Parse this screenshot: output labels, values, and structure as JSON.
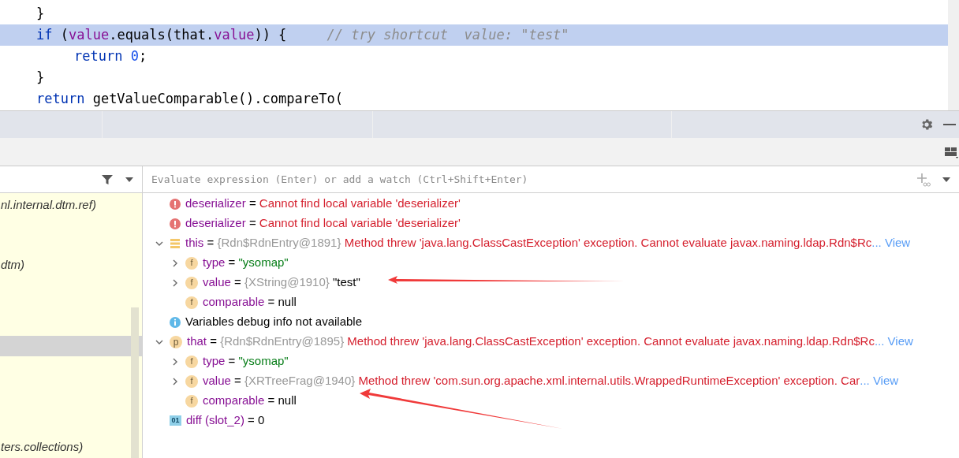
{
  "editor": {
    "lines": [
      {
        "highlighted": false,
        "tokens": [
          {
            "kind": "plain",
            "text": "}"
          }
        ]
      },
      {
        "highlighted": true,
        "tokens": [
          {
            "kind": "keyword",
            "text": "if"
          },
          {
            "kind": "plain",
            "text": " ("
          },
          {
            "kind": "field",
            "text": "value"
          },
          {
            "kind": "plain",
            "text": ".equals(that."
          },
          {
            "kind": "field",
            "text": "value"
          },
          {
            "kind": "plain",
            "text": ")) {"
          },
          {
            "kind": "comment",
            "text": "     // try shortcut  value: \"test\""
          }
        ],
        "children": [
          {
            "highlighted": false,
            "tokens": [
              {
                "kind": "keyword",
                "text": "return"
              },
              {
                "kind": "number",
                "text": " 0"
              },
              {
                "kind": "plain",
                "text": ";"
              }
            ]
          }
        ]
      },
      {
        "highlighted": false,
        "tokens": [
          {
            "kind": "plain",
            "text": "}"
          }
        ]
      },
      {
        "highlighted": false,
        "tokens": [
          {
            "kind": "keyword",
            "text": "return"
          },
          {
            "kind": "plain",
            "text": " getValueComparable().compareTo("
          }
        ]
      }
    ]
  },
  "frames": {
    "items": [
      {
        "label": "nl.internal.dtm.ref)",
        "selected": false
      },
      {
        "selected": false
      },
      {
        "selected": false
      },
      {
        "label": "dtm)",
        "selected": false
      },
      {
        "selected": false
      },
      {
        "selected": false
      },
      {
        "selected": false
      },
      {
        "selected": true
      },
      {
        "selected": false
      },
      {
        "selected": false
      },
      {
        "selected": false
      },
      {
        "selected": false
      },
      {
        "label": "ters.collections)",
        "selected": false
      }
    ]
  },
  "watch": {
    "placeholder": "Evaluate expression (Enter) or add a watch (Ctrl+Shift+Enter)"
  },
  "variables": [
    {
      "kind": "error",
      "name": "deserializer",
      "operator": "=",
      "value": {
        "kind": "error",
        "text": "Cannot find local variable 'deserializer'"
      }
    },
    {
      "kind": "error",
      "name": "deserializer",
      "operator": "=",
      "value": {
        "kind": "error",
        "text": "Cannot find local variable 'deserializer'"
      }
    },
    {
      "kind": "object",
      "name": "this",
      "operator": "=",
      "expanded": true,
      "ref": "{Rdn$RdnEntry@1891}",
      "value": {
        "kind": "error",
        "text": "Method threw 'java.lang.ClassCastException' exception. Cannot evaluate javax.naming.ldap.Rdn$Rc"
      },
      "link": "... View",
      "children": [
        {
          "kind": "field",
          "badge": "f",
          "name": "type",
          "operator": "=",
          "expanded": false,
          "value": {
            "kind": "string",
            "text": "\"ysomap\""
          }
        },
        {
          "kind": "field",
          "badge": "f",
          "name": "value",
          "operator": "=",
          "expanded": false,
          "ref": "{XString@1910}",
          "value": {
            "kind": "plain",
            "text": "\"test\""
          }
        },
        {
          "kind": "field",
          "badge": "f",
          "name": "comparable",
          "operator": "=",
          "value": {
            "kind": "plain",
            "text": "null"
          }
        }
      ]
    },
    {
      "kind": "info",
      "name": "Variables debug info not available"
    },
    {
      "kind": "param",
      "badge": "p",
      "name": "that",
      "operator": "=",
      "expanded": true,
      "ref": "{Rdn$RdnEntry@1895}",
      "value": {
        "kind": "error",
        "text": "Method threw 'java.lang.ClassCastException' exception. Cannot evaluate javax.naming.ldap.Rdn$Rc"
      },
      "link": "... View",
      "children": [
        {
          "kind": "field",
          "badge": "f",
          "name": "type",
          "operator": "=",
          "expanded": false,
          "value": {
            "kind": "string",
            "text": "\"ysomap\""
          }
        },
        {
          "kind": "field",
          "badge": "f",
          "name": "value",
          "operator": "=",
          "expanded": false,
          "ref": "{XRTreeFrag@1940}",
          "value": {
            "kind": "error",
            "text": "Method threw 'com.sun.org.apache.xml.internal.utils.WrappedRuntimeException' exception. Car"
          },
          "link": "... View"
        },
        {
          "kind": "field",
          "badge": "f",
          "name": "comparable",
          "operator": "=",
          "value": {
            "kind": "plain",
            "text": "null"
          }
        }
      ]
    },
    {
      "kind": "primitive",
      "badge": "01",
      "name": "diff (slot_2)",
      "operator": "=",
      "value": {
        "kind": "plain",
        "text": "0"
      }
    }
  ]
}
